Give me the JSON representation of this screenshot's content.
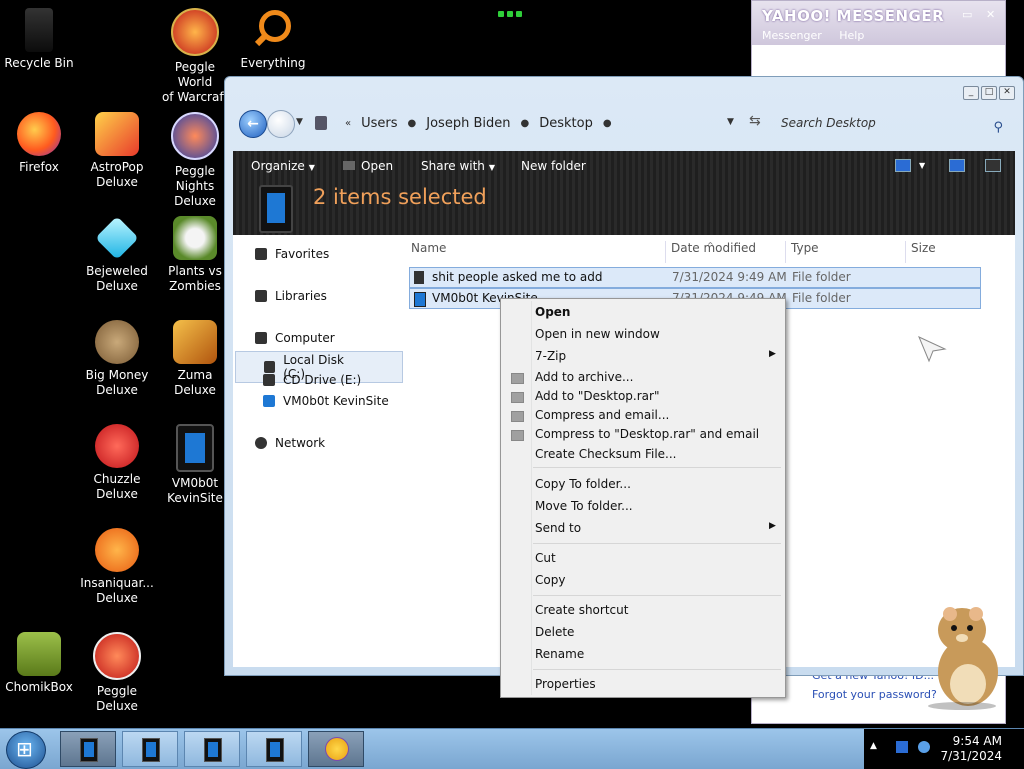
{
  "desktop": {
    "icons": [
      {
        "label": "Recycle Bin"
      },
      {
        "label": "Peggle World\nof Warcraft ..."
      },
      {
        "label": "Everything"
      },
      {
        "label": "Firefox"
      },
      {
        "label": "AstroPop\nDeluxe"
      },
      {
        "label": "Peggle Nights\nDeluxe"
      },
      {
        "label": "Bejeweled\nDeluxe"
      },
      {
        "label": "Plants vs\nZombies"
      },
      {
        "label": "Big Money\nDeluxe"
      },
      {
        "label": "Zuma Deluxe"
      },
      {
        "label": "Chuzzle\nDeluxe"
      },
      {
        "label": "VM0b0t\nKevinSite"
      },
      {
        "label": "Insaniquar...\nDeluxe"
      },
      {
        "label": "ChomikBox"
      },
      {
        "label": "Peggle Deluxe"
      }
    ]
  },
  "yahoo": {
    "title": "YAHOO! MESSENGER",
    "menu": [
      "Messenger",
      "Help"
    ],
    "links": [
      "Get a new Yahoo! ID...",
      "Forgot your password?"
    ]
  },
  "explorer": {
    "breadcrumbs": [
      "Users",
      "Joseph Biden",
      "Desktop"
    ],
    "search_placeholder": "Search Desktop",
    "toolbar": {
      "organize": "Organize",
      "open": "Open",
      "share_with": "Share with",
      "new_folder": "New folder"
    },
    "selection_text": "2 items selected",
    "nav": {
      "favorites": "Favorites",
      "libraries": "Libraries",
      "computer": "Computer",
      "local_disk": "Local Disk (C:)",
      "cd_drive": "CD Drive (E:)",
      "vm": "VM0b0t KevinSite",
      "network": "Network"
    },
    "columns": [
      "Name",
      "Date modified",
      "Type",
      "Size"
    ],
    "rows": [
      {
        "name": "shit people asked me to add",
        "date": "7/31/2024 9:49 AM",
        "type": "File folder"
      },
      {
        "name": "VM0b0t KevinSite",
        "date": "7/31/2024 9:49 AM",
        "type": "File folder"
      }
    ]
  },
  "context_menu": {
    "open": "Open",
    "open_new_window": "Open in new window",
    "seven_zip": "7-Zip",
    "add_archive": "Add to archive...",
    "add_desktop_rar": "Add to \"Desktop.rar\"",
    "compress_email": "Compress and email...",
    "compress_desktop_email": "Compress to \"Desktop.rar\" and email",
    "checksum": "Create Checksum File...",
    "copy_to": "Copy To folder...",
    "move_to": "Move To folder...",
    "send_to": "Send to",
    "cut": "Cut",
    "copy": "Copy",
    "create_shortcut": "Create shortcut",
    "delete": "Delete",
    "rename": "Rename",
    "properties": "Properties"
  },
  "taskbar": {
    "time": "9:54 AM",
    "date": "7/31/2024"
  }
}
